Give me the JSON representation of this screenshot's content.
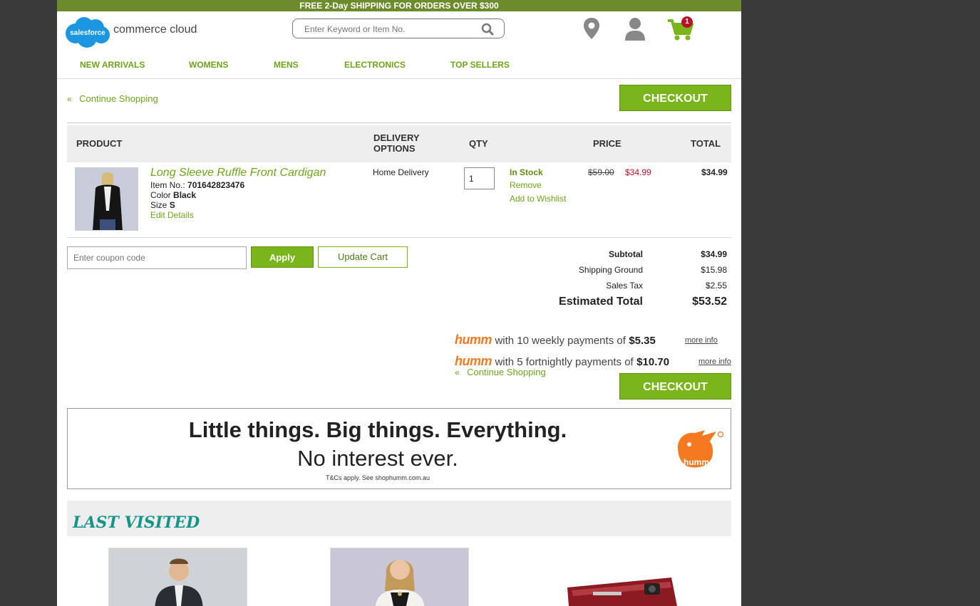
{
  "promo": {
    "bold": "FREE 2-Day SHIPPING",
    "rest": " FOR ORDERS OVER $300"
  },
  "logo": {
    "cloud_text": "salesforce",
    "text": "commerce cloud"
  },
  "search": {
    "placeholder": "Enter Keyword or Item No."
  },
  "header_icons": {
    "cart_count": "1"
  },
  "nav": [
    "NEW ARRIVALS",
    "WOMENS",
    "MENS",
    "ELECTRONICS",
    "TOP SELLERS"
  ],
  "continue_shopping": "Continue Shopping",
  "checkout_label": "CHECKOUT",
  "table_headers": {
    "product": "PRODUCT",
    "delivery": "DELIVERY OPTIONS",
    "qty": "QTY",
    "price": "PRICE",
    "total": "TOTAL"
  },
  "item": {
    "name": "Long Sleeve Ruffle Front Cardigan",
    "item_no_label": "Item No.:",
    "item_no": "701642823476",
    "color_label": "Color",
    "color": "Black",
    "size_label": "Size",
    "size": "S",
    "edit": "Edit Details",
    "delivery": "Home Delivery",
    "qty": "1",
    "stock": "In Stock",
    "remove": "Remove",
    "wishlist": "Add to Wishlist",
    "old_price": "$59.00",
    "sale_price": "$34.99",
    "total": "$34.99"
  },
  "coupon": {
    "placeholder": "Enter coupon code",
    "apply": "Apply",
    "update": "Update Cart"
  },
  "summary": {
    "subtotal_label": "Subtotal",
    "subtotal": "$34.99",
    "shipping_label": "Shipping Ground",
    "shipping": "$15.98",
    "tax_label": "Sales Tax",
    "tax": "$2.55",
    "est_label": "Estimated Total",
    "est": "$53.52"
  },
  "humm": {
    "logo": "humm",
    "weekly_text": "with 10 weekly payments of",
    "weekly_amount": "$5.35",
    "fortnightly_text": "with 5 fortnightly payments of",
    "fortnightly_amount": "$10.70",
    "more_info": "more info"
  },
  "banner": {
    "line1": "Little things. Big things. Everything.",
    "line2": "No interest ever.",
    "tc": "T&Cs apply. See shophumm.com.au",
    "logo_text": "humm"
  },
  "last_visited": {
    "title": "LAST VISITED"
  },
  "colors": {
    "brand_green": "#79b51b",
    "promo_bar": "#6d8b2b",
    "humm_orange": "#f47920",
    "sale_red": "#b8122b",
    "teal": "#17948a"
  }
}
